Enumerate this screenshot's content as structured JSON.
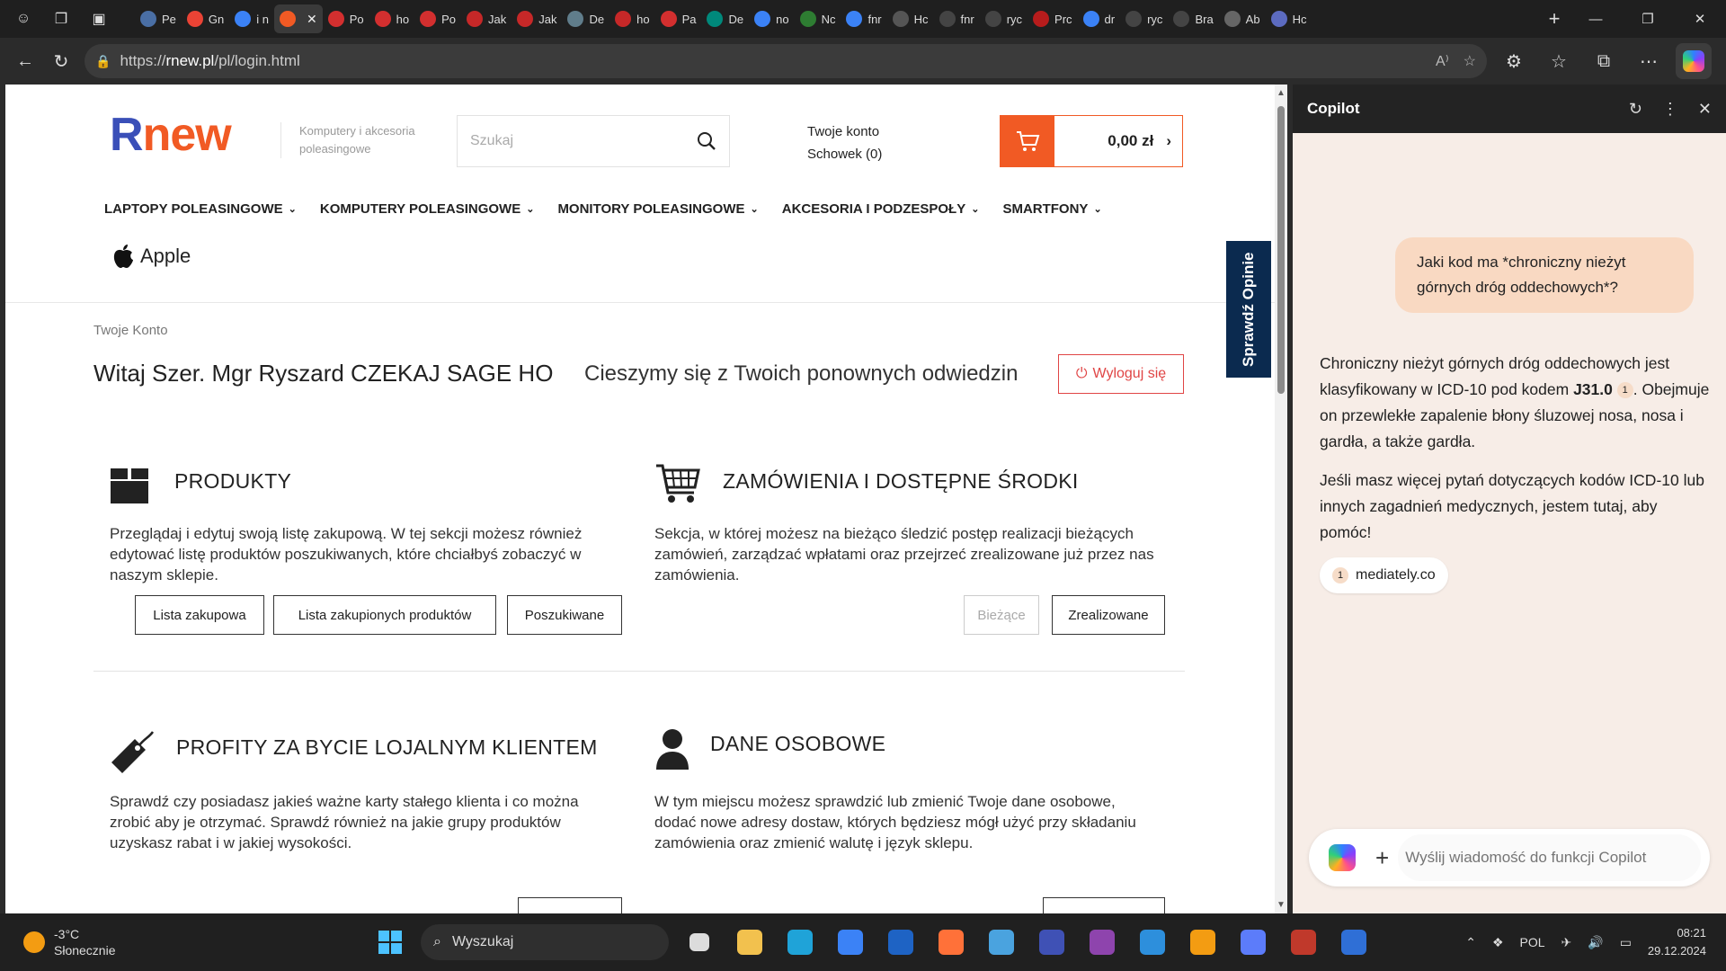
{
  "browser": {
    "tabs": [
      {
        "label": "Pe",
        "color": "#4a6fa5"
      },
      {
        "label": "Gn",
        "color": "#ea4335"
      },
      {
        "label": "i n",
        "color": "#3b82f6"
      },
      {
        "label": "",
        "color": "#f15a24",
        "active": true
      },
      {
        "label": "Po",
        "color": "#d32f2f"
      },
      {
        "label": "ho",
        "color": "#d32f2f"
      },
      {
        "label": "Po",
        "color": "#d32f2f"
      },
      {
        "label": "Jak",
        "color": "#c62828"
      },
      {
        "label": "Jak",
        "color": "#c62828"
      },
      {
        "label": "De",
        "color": "#607d8b"
      },
      {
        "label": "ho",
        "color": "#c62828"
      },
      {
        "label": "Pa",
        "color": "#d32f2f"
      },
      {
        "label": "De",
        "color": "#00897b"
      },
      {
        "label": "no",
        "color": "#3b82f6"
      },
      {
        "label": "Nc",
        "color": "#2e7d32"
      },
      {
        "label": "fnr",
        "color": "#3b82f6"
      },
      {
        "label": "Hc",
        "color": "#555555"
      },
      {
        "label": "fnr",
        "color": "#444444"
      },
      {
        "label": "ryc",
        "color": "#444444"
      },
      {
        "label": "Prc",
        "color": "#b71c1c"
      },
      {
        "label": "dr",
        "color": "#3b82f6"
      },
      {
        "label": "ryc",
        "color": "#444444"
      },
      {
        "label": "Bra",
        "color": "#444444"
      },
      {
        "label": "Ab",
        "color": "#666666"
      },
      {
        "label": "Hc",
        "color": "#5c6bc0"
      }
    ],
    "url_prefix": "https://",
    "url_host": "rnew.pl",
    "url_path": "/pl/login.html"
  },
  "site": {
    "logo_r": "R",
    "logo_rest": "new",
    "tagline": "Komputery i akcesoria poleasingowe",
    "search_placeholder": "Szukaj",
    "account_label": "Twoje konto",
    "wishlist_label": "Schowek (0)",
    "cart_total": "0,00 zł",
    "menu": [
      "LAPTOPY POLEASINGOWE",
      "KOMPUTERY POLEASINGOWE",
      "MONITORY POLEASINGOWE",
      "AKCESORIA I PODZESPOŁY",
      "SMARTFONY"
    ],
    "apple_label": "Apple",
    "review_tab": "Sprawdź Opinie",
    "breadcrumb": "Twoje Konto",
    "welcome": "Witaj Szer. Mgr Ryszard CZEKAJ SAGE HO",
    "welcome_sub": "Cieszymy się z Twoich ponownych odwiedzin",
    "logout_label": "Wyloguj się",
    "sections": {
      "products": {
        "title": "PRODUKTY",
        "desc": "Przeglądaj i edytuj swoją listę zakupową. W tej sekcji możesz również edytować listę produktów poszukiwanych, które chciałbyś zobaczyć w naszym sklepie.",
        "btn1": "Lista zakupowa",
        "btn2": "Lista zakupionych produktów",
        "btn3": "Poszukiwane"
      },
      "orders": {
        "title": "ZAMÓWIENIA I DOSTĘPNE ŚRODKI",
        "desc": "Sekcja, w której możesz na bieżąco śledzić postęp realizacji bieżących zamówień, zarządzać wpłatami oraz przejrzeć zrealizowane już przez nas zamówienia.",
        "btn1": "Bieżące",
        "btn2": "Zrealizowane"
      },
      "loyalty": {
        "title": "PROFITY ZA BYCIE LOJALNYM KLIENTEM",
        "desc": "Sprawdź czy posiadasz jakieś ważne karty stałego klienta i co można zrobić aby je otrzymać. Sprawdź również na jakie grupy produktów uzyskasz rabat i w jakiej wysokości."
      },
      "personal": {
        "title": "DANE OSOBOWE",
        "desc": "W tym miejscu możesz sprawdzić lub zmienić Twoje dane osobowe, dodać nowe adresy dostaw, których będziesz mógł użyć przy składaniu zamówienia oraz zmienić walutę i język sklepu."
      }
    }
  },
  "copilot": {
    "title": "Copilot",
    "user_message": "Jaki kod ma *chroniczny nieżyt górnych dróg oddechowych*?",
    "answer_p1_a": "Chroniczny nieżyt górnych dróg oddechowych jest klasyfikowany w ICD-10 pod kodem ",
    "answer_code": "J31.0",
    "answer_cite": "1",
    "answer_p1_b": ". Obejmuje on przewlekłe zapalenie błony śluzowej nosa, nosa i gardła, a także gardła.",
    "answer_p2": "Jeśli masz więcej pytań dotyczących kodów ICD-10 lub innych zagadnień medycznych, jestem tutaj, aby pomóc!",
    "source_num": "1",
    "source_label": "mediately.co",
    "input_placeholder": "Wyślij wiadomość do funkcji Copilot"
  },
  "taskbar": {
    "temperature": "-3°C",
    "weather": "Słonecznie",
    "search_label": "Wyszukaj",
    "language": "POL",
    "time": "08:21",
    "date": "29.12.2024",
    "apps": [
      {
        "name": "file-explorer-icon",
        "color": "#f2c14e"
      },
      {
        "name": "edge-icon",
        "color": "#1fa3d8"
      },
      {
        "name": "store-icon",
        "color": "#3b82f6"
      },
      {
        "name": "outlook-icon",
        "color": "#1e63c4"
      },
      {
        "name": "firefox-icon",
        "color": "#ff7139"
      },
      {
        "name": "photos-icon",
        "color": "#4aa3df"
      },
      {
        "name": "save-icon",
        "color": "#3f51b5"
      },
      {
        "name": "podcast-icon",
        "color": "#8e44ad"
      },
      {
        "name": "vscode-icon",
        "color": "#2d8fdc"
      },
      {
        "name": "media-player-icon",
        "color": "#f39c12"
      },
      {
        "name": "virtualbox-icon",
        "color": "#5c7cfa"
      },
      {
        "name": "pdf-reader-icon",
        "color": "#c0392b"
      },
      {
        "name": "azure-icon",
        "color": "#2f6fd6"
      }
    ]
  }
}
